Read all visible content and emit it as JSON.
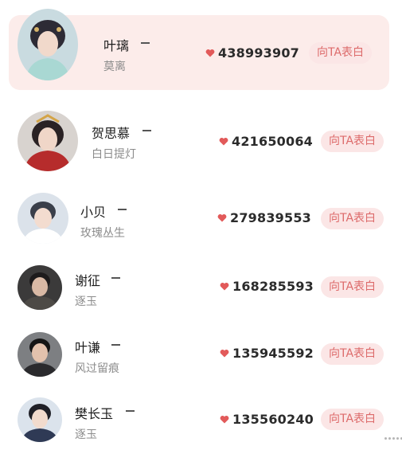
{
  "list": {
    "like_icon": "heart-icon",
    "like_color": "#e25a5a",
    "highlight_color": "#fcecea",
    "items": [
      {
        "name": "叶璃",
        "role": "莫离",
        "score": "438993907",
        "button": "向TA表白"
      },
      {
        "name": "贺思慕",
        "role": "白日提灯",
        "score": "421650064",
        "button": "向TA表白"
      },
      {
        "name": "小贝",
        "role": "玫瑰丛生",
        "score": "279839553",
        "button": "向TA表白"
      },
      {
        "name": "谢征",
        "role": "逐玉",
        "score": "168285593",
        "button": "向TA表白"
      },
      {
        "name": "叶谦",
        "role": "风过留痕",
        "score": "135945592",
        "button": "向TA表白"
      },
      {
        "name": "樊长玉",
        "role": "逐玉",
        "score": "135560240",
        "button": "向TA表白"
      }
    ]
  }
}
